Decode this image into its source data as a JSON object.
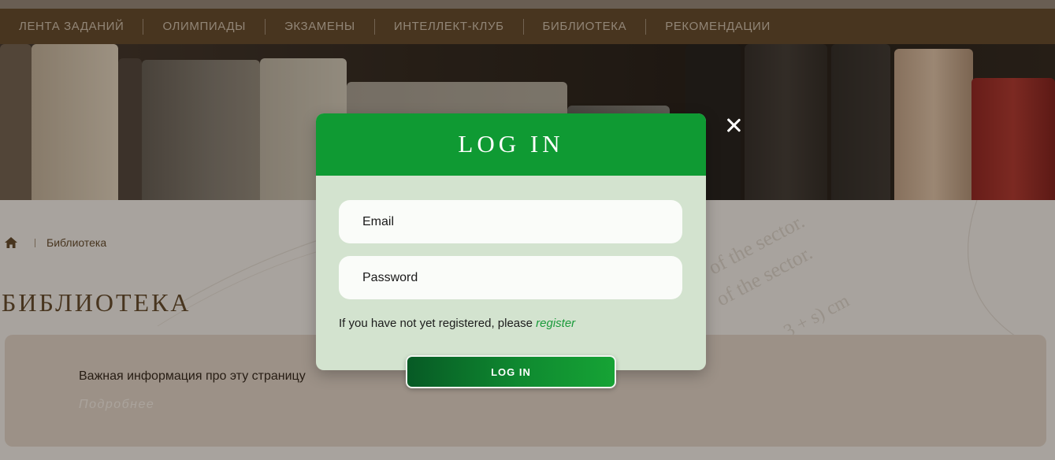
{
  "nav": {
    "items": [
      {
        "label": "ЛЕНТА ЗАДАНИЙ"
      },
      {
        "label": "ОЛИМПИАДЫ"
      },
      {
        "label": "ЭКЗАМЕНЫ"
      },
      {
        "label": "ИНТЕЛЛЕКТ-КЛУБ"
      },
      {
        "label": "БИБЛИОТЕКА"
      },
      {
        "label": "РЕКОМЕНДАЦИИ"
      }
    ]
  },
  "breadcrumb": {
    "home_icon": "home-icon",
    "current": "Библиотека"
  },
  "page": {
    "title": "БИБЛИОТЕКА",
    "info_text": "Важная информация про эту страницу",
    "info_more": "Подробнее"
  },
  "modal": {
    "title": "LOG IN",
    "email_placeholder": "Email",
    "password_placeholder": "Password",
    "register_prompt": "If you have not yet registered, please",
    "register_link": "register",
    "submit_label": "LOG IN",
    "close_icon": "close-icon"
  },
  "colors": {
    "nav_bg": "#5c4326",
    "modal_header": "#0f9a33",
    "modal_body": "#d3e3cf",
    "link": "#199a3a"
  }
}
